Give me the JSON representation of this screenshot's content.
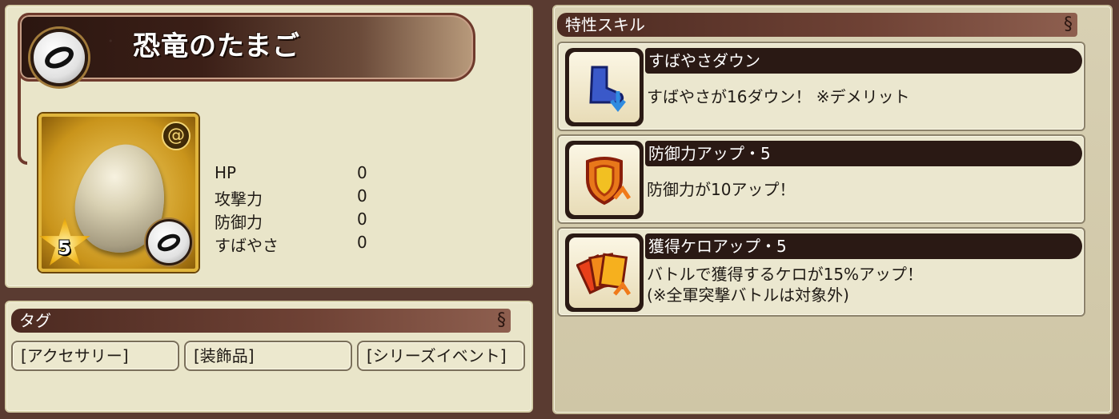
{
  "item": {
    "name": "恐竜のたまご",
    "rarity": "5",
    "stats": [
      {
        "label": "HP",
        "value": "0"
      },
      {
        "label": "攻撃力",
        "value": "0"
      },
      {
        "label": "防御力",
        "value": "0"
      },
      {
        "label": "すばやさ",
        "value": "0"
      }
    ]
  },
  "tags": {
    "title": "タグ",
    "items": [
      "[アクセサリー]",
      "[装飾品]",
      "[シリーズイベント]"
    ]
  },
  "skills": {
    "title": "特性スキル",
    "items": [
      {
        "name": "すばやさダウン",
        "desc": [
          "すばやさが16ダウン！ ※デメリット"
        ],
        "icon": "speed-down-boot-icon"
      },
      {
        "name": "防御力アップ・5",
        "desc": [
          "防御力が10アップ！"
        ],
        "icon": "defense-up-shield-icon"
      },
      {
        "name": "獲得ケロアップ・5",
        "desc": [
          "バトルで獲得するケロが15%アップ！",
          "(※全軍突撃バトルは対象外)"
        ],
        "icon": "kero-up-cards-icon"
      }
    ]
  },
  "colors": {
    "panel": "#e9e5c9",
    "header": "#4c2a21",
    "background": "#5a3b31"
  }
}
